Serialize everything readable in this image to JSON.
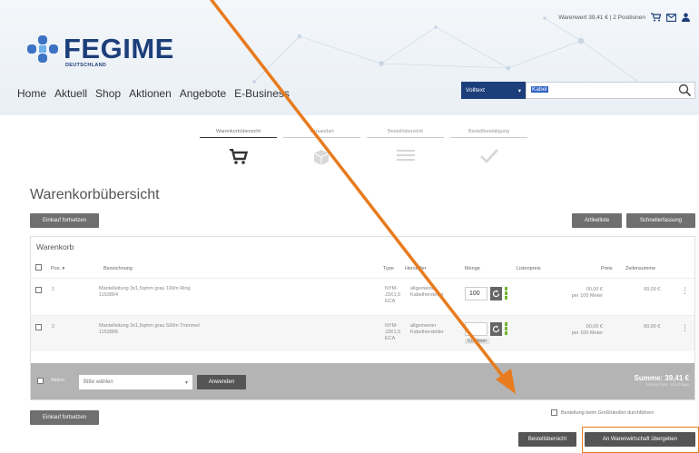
{
  "header": {
    "cart_summary": "Warenwert 39,41 € | 2 Positionen",
    "logo": {
      "word": "FEGIME",
      "subtitle": "DEUTSCHLAND"
    },
    "nav": [
      "Home",
      "Aktuell",
      "Shop",
      "Aktionen",
      "Angebote",
      "E-Business"
    ],
    "search": {
      "scope": "Volltext",
      "query": "Kabel"
    }
  },
  "steps": [
    "Warenkorbübersicht",
    "Versandart",
    "Bestellübersicht",
    "Bestellbestätigung"
  ],
  "page_title": "Warenkorbübersicht",
  "buttons": {
    "continue_top": "Einkauf fortsetzen",
    "article_entry": "Artikelliste",
    "quick_entry": "Schnellerfassung",
    "apply": "Anwenden",
    "continue_bottom": "Einkauf fortsetzen",
    "order_overview": "Bestellübersicht",
    "transfer": "An Warenwirtschaft übergeben"
  },
  "cart": {
    "title": "Warenkorb",
    "columns": [
      "Pos.",
      "Bezeichnung",
      "Type",
      "Hersteller",
      "Menge",
      "Listenpreis",
      "Preis",
      "Zeilensumme"
    ],
    "rows": [
      {
        "pos": "1",
        "name": "Mantelleitung 3x1,5qmm grau 100m Ring",
        "number": "1153804",
        "type": [
          "NYM-",
          "J3X1,5",
          "ECA"
        ],
        "maker": [
          "allgemeiner",
          "Kabelhersteller"
        ],
        "qty": "100",
        "price": "00,00 €",
        "unit": "per 100 Meter",
        "line_total": "00,00 €",
        "stock_note": ""
      },
      {
        "pos": "2",
        "name": "Mantelleitung 3x1,5qmm grau 500m Trommel",
        "number": "1153806",
        "type": [
          "NYM-",
          "J3X1,5",
          "ECA"
        ],
        "maker": [
          "allgemeiner",
          "Kabelhersteller"
        ],
        "qty": "",
        "price": "00,00 €",
        "unit": "per 100 Meter",
        "line_total": "00,00 €",
        "stock_note": "0,0 Meter"
      }
    ],
    "footer": {
      "bulk_label": "Aktion",
      "bulk_select": "Bitte wählen",
      "sum_label": "Summe: 39,41 €",
      "sum_note": "Versand inkl. Zuschläge"
    }
  },
  "checkbox_label": "Bestellung beim Großhändler durchführen",
  "colors": {
    "brand": "#1c3e7a",
    "accent": "#e87b1e",
    "stock": "#73b62e"
  }
}
